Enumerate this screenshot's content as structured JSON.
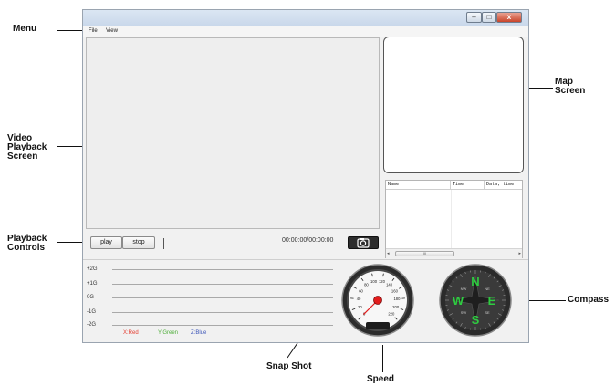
{
  "callouts": {
    "menu": "Menu",
    "map_screen": [
      "Map",
      "Screen"
    ],
    "video_playback_screen": [
      "Video",
      "Playback",
      "Screen"
    ],
    "playback_controls": [
      "Playback",
      "Controls"
    ],
    "compass": "Compass",
    "snap_shot": "Snap Shot",
    "speed": "Speed"
  },
  "menu": {
    "items": [
      "File",
      "View"
    ]
  },
  "window_controls": {
    "minimize": "–",
    "maximize": "□",
    "close": "x"
  },
  "playback": {
    "play_label": "play",
    "stop_label": "stop",
    "time_display": "00:00:00/00:00:00",
    "progress": 0
  },
  "table": {
    "columns": [
      "Name",
      "Time",
      "Data, time"
    ],
    "scroll_marker": "III"
  },
  "accelerometer": {
    "levels": [
      "+2G",
      "+1G",
      "0G",
      "-1G",
      "-2G"
    ],
    "legend": [
      {
        "label": "X:Red",
        "color": "#e43c2f"
      },
      {
        "label": "Y:Green",
        "color": "#4fae3a"
      },
      {
        "label": "Z:Blue",
        "color": "#3b54b8"
      }
    ]
  },
  "speedometer": {
    "ticks": [
      "0",
      "20",
      "40",
      "60",
      "80",
      "100",
      "120",
      "140",
      "160",
      "180",
      "200",
      "220"
    ],
    "value": 0
  },
  "compass": {
    "labels": [
      "N",
      "E",
      "S",
      "W",
      "NE",
      "SE",
      "SW",
      "NW"
    ]
  },
  "colors": {
    "compass_green": "#2ecc40",
    "needle_red": "#e31c1c"
  }
}
